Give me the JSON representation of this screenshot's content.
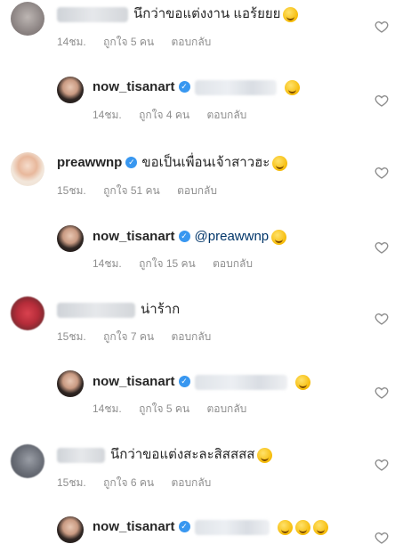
{
  "comments": [
    {
      "text": "นึกว่าขอแต่งงาน แอร้ยยย",
      "time": "14ชม.",
      "likes": "ถูกใจ 5 คน",
      "reply_label": "ตอบกลับ"
    },
    {
      "username": "now_tisanart",
      "time": "14ชม.",
      "likes": "ถูกใจ 4 คน",
      "reply_label": "ตอบกลับ"
    },
    {
      "username": "preawwnp",
      "text": "ขอเป็นเพื่อนเจ้าสาวฮะ",
      "time": "15ชม.",
      "likes": "ถูกใจ 51 คน",
      "reply_label": "ตอบกลับ"
    },
    {
      "username": "now_tisanart",
      "text": "@preawwnp",
      "time": "14ชม.",
      "likes": "ถูกใจ 15 คน",
      "reply_label": "ตอบกลับ"
    },
    {
      "text": "น่าร้าก",
      "time": "15ชม.",
      "likes": "ถูกใจ 7 คน",
      "reply_label": "ตอบกลับ"
    },
    {
      "username": "now_tisanart",
      "time": "14ชม.",
      "likes": "ถูกใจ 5 คน",
      "reply_label": "ตอบกลับ"
    },
    {
      "text": "นึกว่าขอแต่งสะละสิสสสส",
      "time": "15ชม.",
      "likes": "ถูกใจ 6 คน",
      "reply_label": "ตอบกลับ"
    },
    {
      "username": "now_tisanart"
    }
  ],
  "icons": {
    "like": "heart-outline-icon",
    "verified": "verified-badge-icon"
  },
  "colors": {
    "verified": "#3897f0",
    "meta": "#8e8e8e",
    "text": "#262626"
  }
}
